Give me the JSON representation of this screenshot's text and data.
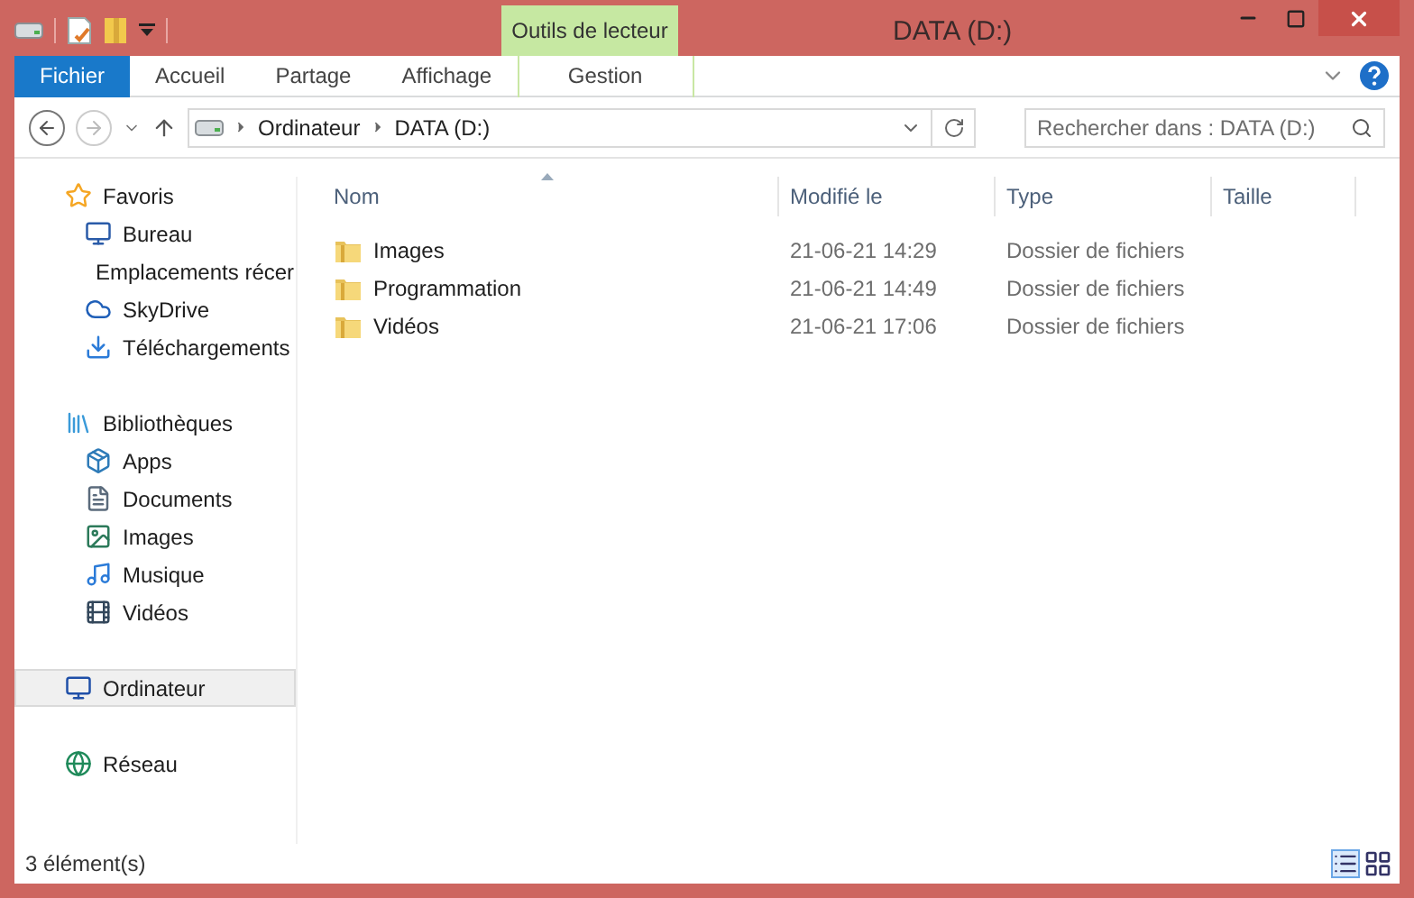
{
  "window": {
    "title": "DATA (D:)"
  },
  "ribbon": {
    "context_label": "Outils de lecteur",
    "tabs": [
      {
        "label": "Fichier",
        "selected": true,
        "kind": "file"
      },
      {
        "label": "Accueil",
        "selected": false,
        "kind": "normal"
      },
      {
        "label": "Partage",
        "selected": false,
        "kind": "normal"
      },
      {
        "label": "Affichage",
        "selected": false,
        "kind": "normal"
      },
      {
        "label": "Gestion",
        "selected": false,
        "kind": "contextual"
      }
    ]
  },
  "address_bar": {
    "path": [
      "Ordinateur",
      "DATA (D:)"
    ]
  },
  "search": {
    "placeholder": "Rechercher dans : DATA (D:)"
  },
  "sidebar": {
    "groups": [
      {
        "label": "Favoris",
        "selected": false,
        "children": [
          {
            "label": "Bureau",
            "selected": false
          },
          {
            "label": "Emplacements récer",
            "selected": false
          },
          {
            "label": "SkyDrive",
            "selected": false
          },
          {
            "label": "Téléchargements",
            "selected": false
          }
        ]
      },
      {
        "label": "Bibliothèques",
        "selected": false,
        "children": [
          {
            "label": "Apps",
            "selected": false
          },
          {
            "label": "Documents",
            "selected": false
          },
          {
            "label": "Images",
            "selected": false
          },
          {
            "label": "Musique",
            "selected": false
          },
          {
            "label": "Vidéos",
            "selected": false
          }
        ]
      },
      {
        "label": "Ordinateur",
        "selected": true
      },
      {
        "label": "Réseau",
        "selected": false
      }
    ]
  },
  "table": {
    "columns": [
      "Nom",
      "Modifié le",
      "Type",
      "Taille"
    ],
    "rows": [
      {
        "name": "Images",
        "modified": "21-06-21 14:29",
        "type": "Dossier de fichiers"
      },
      {
        "name": "Programmation",
        "modified": "21-06-21 14:49",
        "type": "Dossier de fichiers"
      },
      {
        "name": "Vidéos",
        "modified": "21-06-21 17:06",
        "type": "Dossier de fichiers"
      }
    ]
  },
  "status_bar": {
    "count": "3 élément(s)"
  }
}
